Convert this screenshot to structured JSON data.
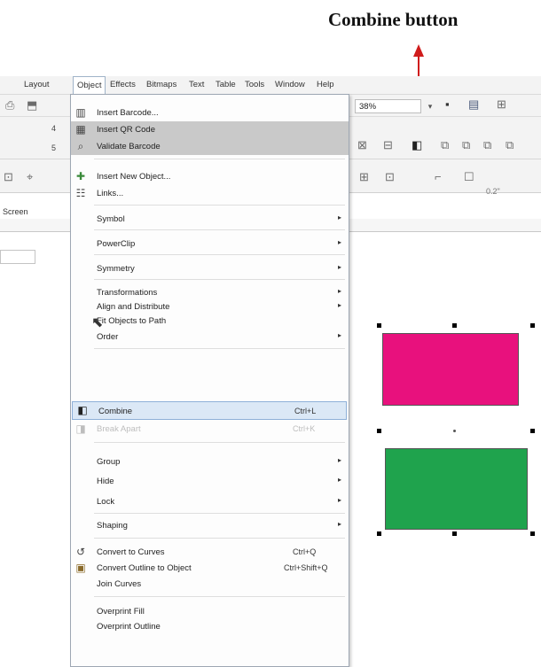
{
  "annotation": {
    "title": "Combine button"
  },
  "menubar": {
    "items": [
      "Layout",
      "Object",
      "Effects",
      "Bitmaps",
      "Text",
      "Table",
      "Tools",
      "Window",
      "Help"
    ]
  },
  "toolbar": {
    "zoom": "38%",
    "zoom_arrow": "▾",
    "left_numbers": [
      "4",
      "5"
    ],
    "outline_width": "0.2\"",
    "tab_label": "Screen"
  },
  "menu": {
    "items": [
      {
        "label": "Insert Barcode...",
        "icon": "barcode-icon",
        "glyph": "▥",
        "style": "normal"
      },
      {
        "label": "Insert QR Code",
        "icon": "qr-code-icon",
        "glyph": "▦",
        "style": "gray"
      },
      {
        "label": "Validate Barcode",
        "icon": "validate-barcode-icon",
        "glyph": "⌕",
        "style": "gray"
      },
      {
        "label": "Insert New Object...",
        "icon": "insert-object-icon",
        "glyph": "✚",
        "style": "normal"
      },
      {
        "label": "Links...",
        "icon": "links-icon",
        "glyph": "☷",
        "style": "normal"
      },
      {
        "label": "Symbol",
        "submenu": true
      },
      {
        "label": "PowerClip",
        "submenu": true
      },
      {
        "label": "Symmetry",
        "submenu": true
      },
      {
        "label": "Transformations",
        "submenu": true
      },
      {
        "label": "Align and Distribute",
        "submenu": true
      },
      {
        "label": "Fit Objects to Path"
      },
      {
        "label": "Order",
        "submenu": true
      },
      {
        "label": "Combine",
        "shortcut": "Ctrl+L",
        "icon": "combine-icon",
        "glyph": "◧",
        "style": "highlight"
      },
      {
        "label": "Break Apart",
        "shortcut": "Ctrl+K",
        "icon": "break-apart-icon",
        "glyph": "◨",
        "style": "disabled"
      },
      {
        "label": "Group",
        "submenu": true
      },
      {
        "label": "Hide",
        "submenu": true
      },
      {
        "label": "Lock",
        "submenu": true
      },
      {
        "label": "Shaping",
        "submenu": true
      },
      {
        "label": "Convert to Curves",
        "shortcut": "Ctrl+Q",
        "icon": "convert-curves-icon",
        "glyph": "↺"
      },
      {
        "label": "Convert Outline to Object",
        "shortcut": "Ctrl+Shift+Q",
        "icon": "outline-object-icon",
        "glyph": "▣"
      },
      {
        "label": "Join Curves"
      },
      {
        "label": "Overprint Fill"
      },
      {
        "label": "Overprint Outline"
      }
    ]
  },
  "colors": {
    "pink": "#e8117d",
    "green": "#1fa34d",
    "arrow": "#d01c1c",
    "highlight": "#dbe8f6"
  },
  "icons": {
    "submenu_arrow": "▸",
    "cursor": "⬉"
  }
}
